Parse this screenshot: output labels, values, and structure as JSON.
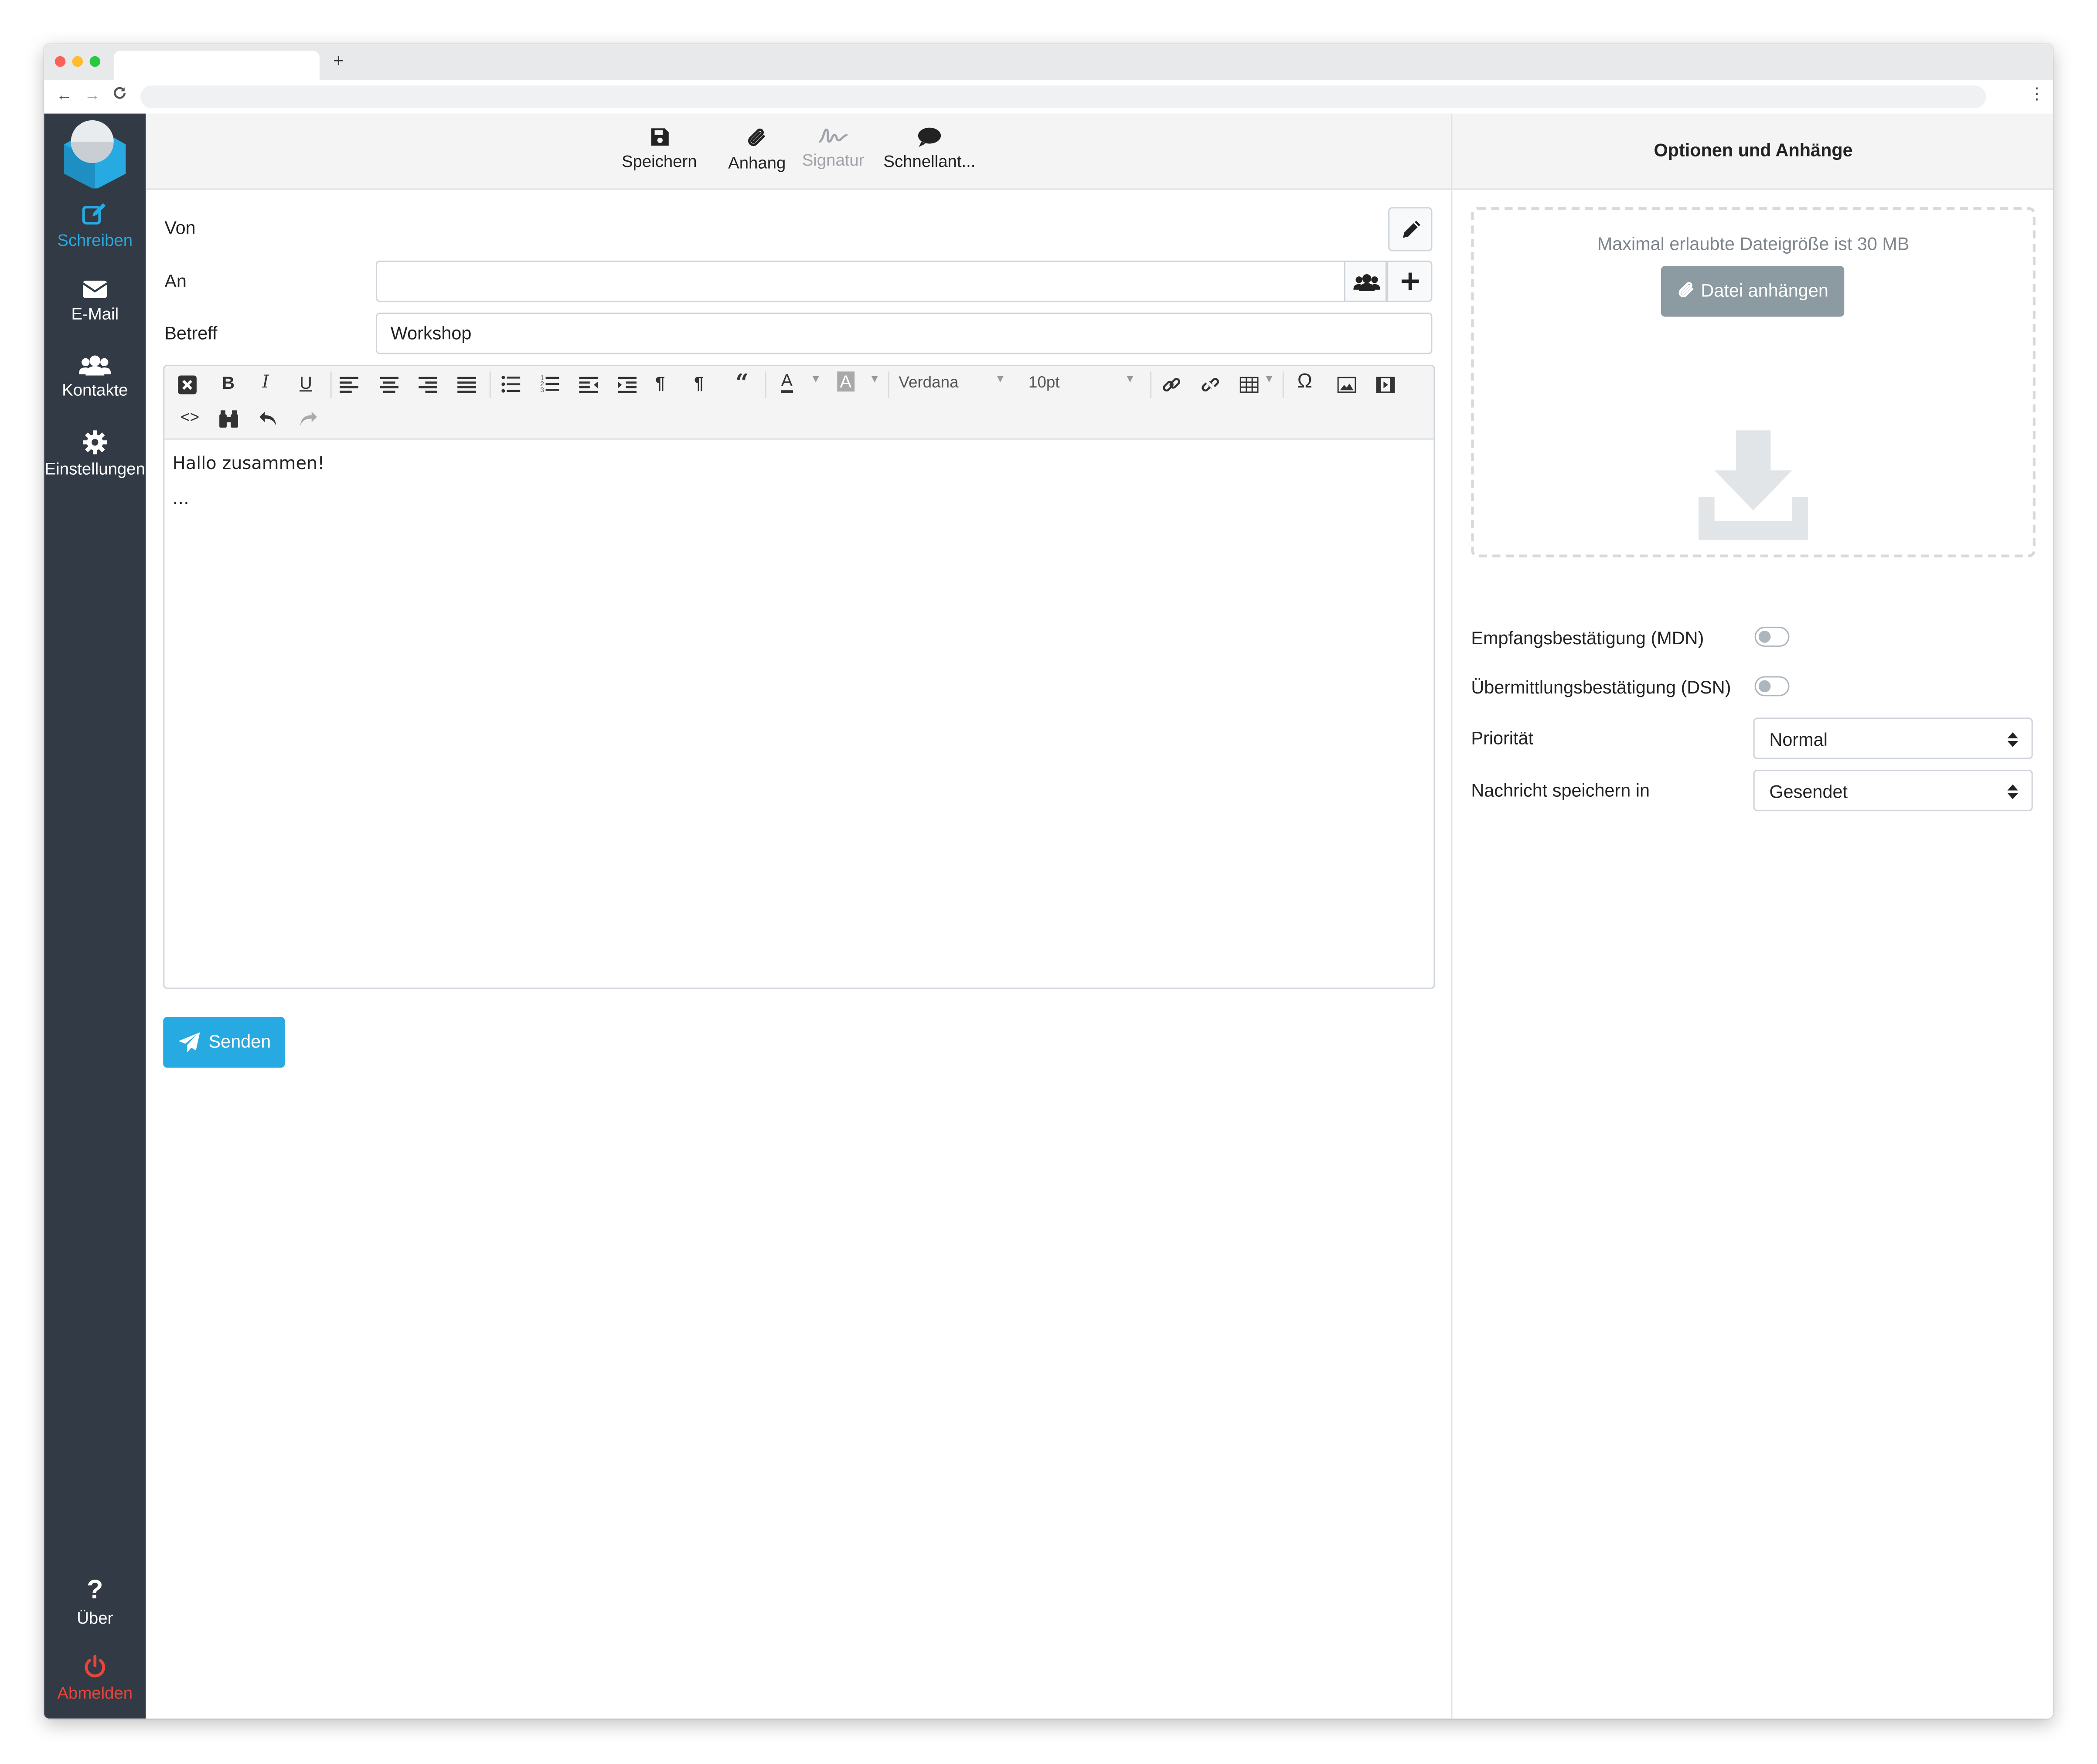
{
  "browser": {
    "new_tab_symbol": "+",
    "back": "←",
    "forward": "→",
    "reload": "C",
    "menu": "⋮"
  },
  "sidebar": {
    "items": [
      {
        "label": "Schreiben",
        "icon": "compose-icon"
      },
      {
        "label": "E-Mail",
        "icon": "envelope-icon"
      },
      {
        "label": "Kontakte",
        "icon": "contacts-icon"
      },
      {
        "label": "Einstellungen",
        "icon": "gear-icon"
      }
    ],
    "about_label": "Über",
    "logout_label": "Abmelden",
    "active_color": "#27aae1",
    "logout_color": "#e6463b"
  },
  "toolbar": {
    "save_label": "Speichern",
    "attachment_label": "Anhang",
    "signature_label": "Signatur",
    "quick_reply_label": "Schnellant..."
  },
  "compose": {
    "from_label": "Von",
    "to_label": "An",
    "to_value": "",
    "subject_label": "Betreff",
    "subject_value": "Workshop",
    "font_name": "Verdana",
    "font_size": "10pt",
    "body_line1": "Hallo zusammen!",
    "body_line2": "...",
    "send_label": "Senden"
  },
  "options": {
    "title": "Optionen und Anhänge",
    "max_size_text": "Maximal erlaubte Dateigröße ist 30 MB",
    "attach_button": "Datei anhängen",
    "mdn_label": "Empfangsbestätigung (MDN)",
    "mdn_on": false,
    "dsn_label": "Übermittlungsbestätigung (DSN)",
    "dsn_on": false,
    "priority_label": "Priorität",
    "priority_value": "Normal",
    "save_in_label": "Nachricht speichern in",
    "save_in_value": "Gesendet"
  }
}
